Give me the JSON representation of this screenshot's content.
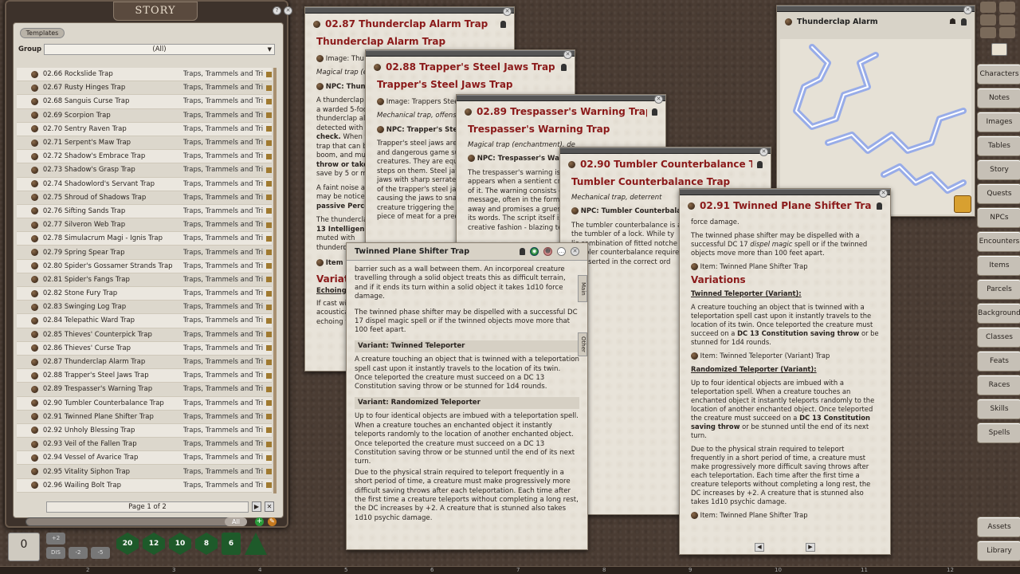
{
  "story_panel": {
    "title": "STORY",
    "templates_label": "Templates",
    "group_label": "Group",
    "group_value": "(All)",
    "items": [
      {
        "name": "02.66 Rockslide Trap",
        "group": "Traps, Trammels and Trigg"
      },
      {
        "name": "02.67 Rusty Hinges Trap",
        "group": "Traps, Trammels and Trigg"
      },
      {
        "name": "02.68 Sanguis Curse Trap",
        "group": "Traps, Trammels and Trigg"
      },
      {
        "name": "02.69 Scorpion Trap",
        "group": "Traps, Trammels and Trigg"
      },
      {
        "name": "02.70 Sentry Raven Trap",
        "group": "Traps, Trammels and Trigg"
      },
      {
        "name": "02.71 Serpent's Maw Trap",
        "group": "Traps, Trammels and Trigg"
      },
      {
        "name": "02.72 Shadow's Embrace Trap",
        "group": "Traps, Trammels and Trigg"
      },
      {
        "name": "02.73 Shadow's Grasp Trap",
        "group": "Traps, Trammels and Trigg"
      },
      {
        "name": "02.74 Shadowlord's Servant Trap",
        "group": "Traps, Trammels and Trigg"
      },
      {
        "name": "02.75 Shroud of Shadows Trap",
        "group": "Traps, Trammels and Trigg"
      },
      {
        "name": "02.76 Sifting Sands Trap",
        "group": "Traps, Trammels and Trigg"
      },
      {
        "name": "02.77 Silveron Web Trap",
        "group": "Traps, Trammels and Trigg"
      },
      {
        "name": "02.78 Simulacrum Magi - Ignis Trap",
        "group": "Traps, Trammels and Trigg"
      },
      {
        "name": "02.79 Spring Spear Trap",
        "group": "Traps, Trammels and Trigg"
      },
      {
        "name": "02.80 Spider's Gossamer Strands Trap",
        "group": "Traps, Trammels and Trigg"
      },
      {
        "name": "02.81 Spider's Fangs Trap",
        "group": "Traps, Trammels and Trigg"
      },
      {
        "name": "02.82 Stone Fury Trap",
        "group": "Traps, Trammels and Trigg"
      },
      {
        "name": "02.83 Swinging Log Trap",
        "group": "Traps, Trammels and Trigg"
      },
      {
        "name": "02.84 Telepathic Ward Trap",
        "group": "Traps, Trammels and Trigg"
      },
      {
        "name": "02.85 Thieves' Counterpick Trap",
        "group": "Traps, Trammels and Trigg"
      },
      {
        "name": "02.86 Thieves' Curse Trap",
        "group": "Traps, Trammels and Trigg"
      },
      {
        "name": "02.87 Thunderclap Alarm Trap",
        "group": "Traps, Trammels and Trigg"
      },
      {
        "name": "02.88 Trapper's Steel Jaws Trap",
        "group": "Traps, Trammels and Trigg"
      },
      {
        "name": "02.89 Trespasser's Warning Trap",
        "group": "Traps, Trammels and Trigg"
      },
      {
        "name": "02.90 Tumbler Counterbalance Trap",
        "group": "Traps, Trammels and Trigg"
      },
      {
        "name": "02.91 Twinned Plane Shifter Trap",
        "group": "Traps, Trammels and Trigg"
      },
      {
        "name": "02.92 Unholy Blessing Trap",
        "group": "Traps, Trammels and Trigg"
      },
      {
        "name": "02.93 Veil of the Fallen Trap",
        "group": "Traps, Trammels and Trigg"
      },
      {
        "name": "02.94 Vessel of Avarice Trap",
        "group": "Traps, Trammels and Trigg"
      },
      {
        "name": "02.95 Vitality Siphon Trap",
        "group": "Traps, Trammels and Trigg"
      },
      {
        "name": "02.96 Wailing Bolt Trap",
        "group": "Traps, Trammels and Trigg"
      }
    ],
    "page_label": "Page 1 of 2",
    "filter_all": "All"
  },
  "sidebar": {
    "buttons": [
      "Characters",
      "Notes",
      "Images",
      "Tables",
      "Story",
      "Quests",
      "NPCs",
      "Encounters",
      "Items",
      "Parcels",
      "Background",
      "Classes",
      "Feats",
      "Races",
      "Skills",
      "Spells"
    ],
    "bottom": [
      "Assets",
      "Library"
    ]
  },
  "win1": {
    "header": "02.87 Thunderclap Alarm Trap",
    "title": "Thunderclap Alarm Trap",
    "image": "Image: Thu",
    "type": "Magical trap (evo",
    "npc": "NPC: Thund",
    "body": [
      "A thunderclap al",
      "a warded 5-foot-",
      "thunderclap alar",
      "detected with a s"
    ],
    "bold1": "check.",
    "body2": [
      "When trig",
      "trap that can be",
      "boom, and must",
      "throw or take 2d",
      "save by 5 or mor"
    ],
    "body3": [
      "A faint noise as t",
      "may be noticed b",
      "passive Percept"
    ],
    "body4": [
      "The thunderclap",
      "13 Intelligence",
      "muted with",
      "thunderclap"
    ],
    "item": "Item",
    "variations": "Variations",
    "echo": "Echoing T",
    "echo_body": [
      "If cast wit",
      "acoustical",
      "echoing th"
    ]
  },
  "win2": {
    "header": "02.88 Trapper's Steel Jaws Trap",
    "title": "Trapper's Steel Jaws Trap",
    "image": "Image: Trappers Stee",
    "type": "Mechanical trap, offensive",
    "npc": "NPC: Trapper's Steel",
    "body": [
      "Trapper's steel jaws are",
      "and dangerous game suc",
      "creatures. They are equal",
      "steps on them. Steel jaws",
      "jaws with sharp serrated s",
      "of the trapper's steel jaws",
      "causing the jaws to snap s",
      "creature triggering the tra",
      "piece of meat for a predat"
    ]
  },
  "win3": {
    "header": "02.89 Trespasser's Warning Trap",
    "title": "Trespasser's Warning Trap",
    "type": "Magical trap (enchantment), de",
    "npc": "NPC: Trespasser's Warni",
    "body": [
      "The trespasser's warning is a g",
      "appears when a sentient creat",
      "of it. The warning consists of a",
      "message, often in the form of a",
      "away and promises a gruesom",
      "its words. The script itself is cle",
      "creative fashion - blazing text,"
    ]
  },
  "win4": {
    "header": "02.90 Tumbler Counterbalance Trap",
    "title": "Tumbler Counterbalance Trap",
    "type": "Mechanical trap, deterrent",
    "npc": "NPC: Tumbler Counterbalance",
    "body": [
      "The tumbler counterbalance is an in",
      "the tumbler of a lock. While ty",
      "lic combination of fitted notche",
      "tumbler counterbalance requires a",
      "be inserted in the correct ord"
    ],
    "body2": [
      "creature attempts to pick a lock",
      "nted, the lock may not be opened",
      "hanism, the mechanism trig",
      "ization, and the tumbler is reset",
      "nterbalance mechanism may b"
    ],
    "bold": "DC 13 Intelligence (Inv",
    "body3": [
      "stigated, the trap is revealed",
      "mizes the mechanism, they re",
      "of the tumbler orientation, wh",
      "second creature."
    ],
    "body4": [
      "ck the lock without the specific",
      "ny lockpicker must make two c"
    ],
    "bold2": "Dexterity (Sleight of Hand) ch",
    "body5": [
      "creature must make a successful DC"
    ],
    "bold3": "D) check.",
    "body5b": "If any of these checks",
    "item": "Item: Tumbler Counterbalance Trap",
    "variations": "ations",
    "var1": "le Pinned Tumbler (Variant)",
    "var1_body": [
      "ble pinned tumbler contains an",
      "s not commonly found on a lock"
    ]
  },
  "win5": {
    "header": "02.91 Twinned Plane Shifter Trap",
    "intro": "force damage.",
    "p1": "The twinned phase shifter may be dispelled with a successful DC 17",
    "p1i": "dispel magic",
    "p1b": "spell or if the twinned objects move more than 100 feet apart.",
    "item1": "Item: Twinned Plane Shifter Trap",
    "variations": "Variations",
    "v1": "Twinned Teleporter (Variant):",
    "v1p": "A creature touching an object that is twinned with a teleportation spell cast upon it instantly travels to the location of its twin. Once teleported the creature must succeed on a",
    "v1b": "DC 13 Constitution saving throw",
    "v1e": "or be stunned for 1d4 rounds.",
    "item2": "Item: Twinned Teleporter (Variant) Trap",
    "v2": "Randomized Teleporter (Variant):",
    "v2p": "Up to four identical objects are imbued with a teleportation spell. When a creature touches an enchanted object it instantly teleports randomly to the location of another enchanted object. Once teleported the creature must succeed on a",
    "v2b": "DC 13 Constitution saving throw",
    "v2e": "or be stunned until the end of its next turn.",
    "p3": "Due to the physical strain required to teleport frequently in a short period of time, a creature must make progressively more difficult saving throws after each teleportation. Each time after the first time a creature teleports without completing a long rest, the DC increases by +2. A creature that is stunned also takes 1d10 psychic damage.",
    "item3": "Item: Twinned Plane Shifter Trap"
  },
  "win6": {
    "header": "Twinned Plane Shifter Trap",
    "p1": "barrier such as a wall between them. An incorporeal creature travelling through a solid object treats this as difficult terrain, and if it ends its turn within a solid object it takes 1d10 force damage.",
    "p2": "The twinned phase shifter may be dispelled with a successful DC 17 dispel magic spell or if the twinned objects move more that 100 feet apart.",
    "s1": "Variant: Twinned Teleporter",
    "p3": "A creature touching an object that is twinned with a teleportation spell cast upon it instantly travels to the location of its twin. Once teleported the creature must succeed on a DC 13 Constitution saving throw or be stunned for 1d4 rounds.",
    "s2": "Variant: Randomized Teleporter",
    "p4": "Up to four identical objects are imbued with a teleportation spell. When a creature touches an enchanted object it instantly teleports randomly to the location of another enchanted object. Once teleported the creature must succeed on a DC 13 Constitution saving throw or be stunned until the end of its next turn.",
    "p5": "Due to the physical strain required to teleport frequently in a short period of time, a creature must make progressively more difficult saving throws after each teleportation. Each time after the first time a creature teleports without completing a long rest, the DC increases by +2. A creature that is stunned also takes 1d10 psychic damage.",
    "tab_main": "Main",
    "tab_other": "Other"
  },
  "image_win": {
    "title": "Thunderclap Alarm"
  },
  "dice": [
    "20",
    "12",
    "10",
    "8",
    "6",
    ""
  ],
  "mod_buttons": [
    "DIS",
    "-2",
    "-5",
    "0"
  ],
  "ruler": [
    "2",
    "3",
    "4",
    "5",
    "6",
    "7",
    "8",
    "9",
    "10",
    "11",
    "12"
  ],
  "colors": {
    "accent_red": "#8b1a1a",
    "paper": "#e8e3d9",
    "lightning": "#3a6cff"
  }
}
